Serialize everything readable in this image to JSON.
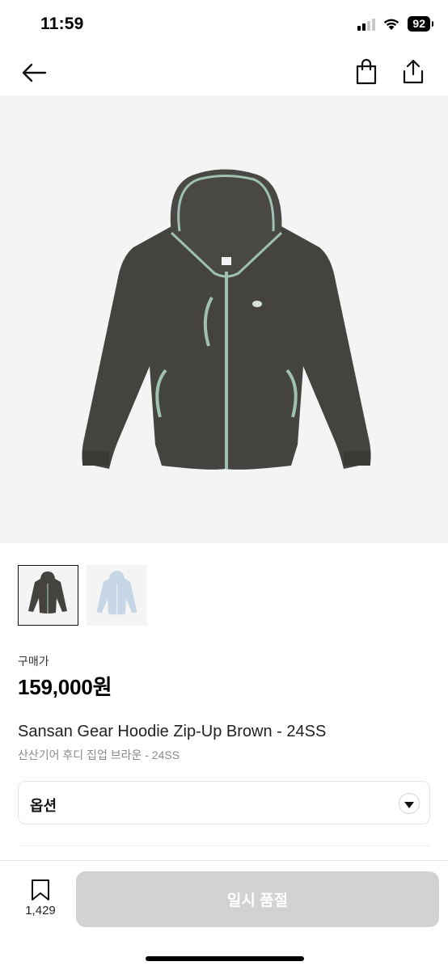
{
  "status_bar": {
    "time": "11:59",
    "battery": "92",
    "icons": [
      "cellular-signal-icon",
      "wifi-icon",
      "battery-icon"
    ]
  },
  "nav": {
    "icons": [
      "back-arrow-icon",
      "shopping-bag-icon",
      "share-icon"
    ]
  },
  "product": {
    "price_label": "구매가",
    "price": "159,000원",
    "title_en": "Sansan Gear Hoodie Zip-Up Brown - 24SS",
    "title_ko": "산산기어 후디 집업 브라운 - 24SS",
    "image_color": "#454340",
    "trim_color": "#9fc0b3",
    "thumbnails": [
      {
        "variant": "brown",
        "color": "#454340",
        "selected": true
      },
      {
        "variant": "light-blue",
        "color": "#c7d6e6",
        "selected": false
      }
    ]
  },
  "options": {
    "label": "옵션"
  },
  "bottom_bar": {
    "bookmark_count": "1,429",
    "buy_button_label": "일시 품절",
    "buy_button_color": "#d2d2d2"
  }
}
